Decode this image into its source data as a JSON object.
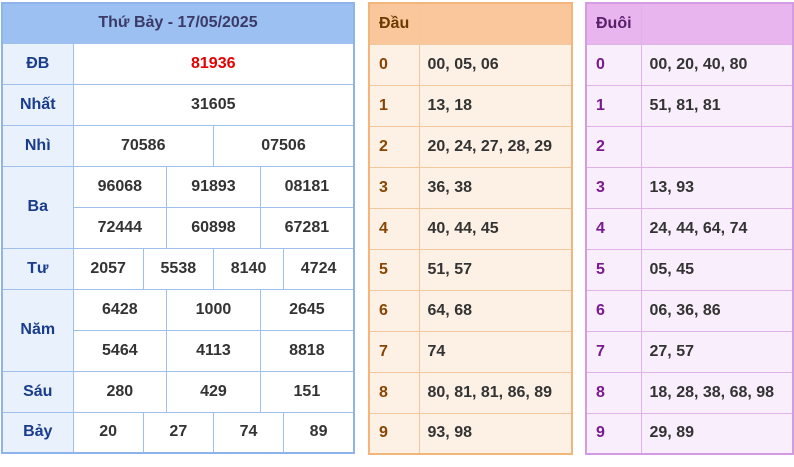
{
  "results": {
    "title": "Thứ Bảy - 17/05/2025",
    "prizes": {
      "db": {
        "label": "ĐB",
        "values": [
          "81936"
        ]
      },
      "nhat": {
        "label": "Nhất",
        "values": [
          "31605"
        ]
      },
      "nhi": {
        "label": "Nhì",
        "values": [
          "70586",
          "07506"
        ]
      },
      "ba": {
        "label": "Ba",
        "values": [
          "96068",
          "91893",
          "08181",
          "72444",
          "60898",
          "67281"
        ]
      },
      "tu": {
        "label": "Tư",
        "values": [
          "2057",
          "5538",
          "8140",
          "4724"
        ]
      },
      "nam": {
        "label": "Năm",
        "values": [
          "6428",
          "1000",
          "2645",
          "5464",
          "4113",
          "8818"
        ]
      },
      "sau": {
        "label": "Sáu",
        "values": [
          "280",
          "429",
          "151"
        ]
      },
      "bay": {
        "label": "Bảy",
        "values": [
          "20",
          "27",
          "74",
          "89"
        ]
      }
    }
  },
  "dau": {
    "header": "Đầu",
    "rows": [
      {
        "digit": "0",
        "values": "00, 05, 06"
      },
      {
        "digit": "1",
        "values": "13, 18"
      },
      {
        "digit": "2",
        "values": "20, 24, 27, 28, 29"
      },
      {
        "digit": "3",
        "values": "36, 38"
      },
      {
        "digit": "4",
        "values": "40, 44, 45"
      },
      {
        "digit": "5",
        "values": "51, 57"
      },
      {
        "digit": "6",
        "values": "64, 68"
      },
      {
        "digit": "7",
        "values": "74"
      },
      {
        "digit": "8",
        "values": "80, 81, 81, 86, 89"
      },
      {
        "digit": "9",
        "values": "93, 98"
      }
    ]
  },
  "duoi": {
    "header": "Đuôi",
    "rows": [
      {
        "digit": "0",
        "values": "00, 20, 40, 80"
      },
      {
        "digit": "1",
        "values": "51, 81, 81"
      },
      {
        "digit": "2",
        "values": ""
      },
      {
        "digit": "3",
        "values": "13, 93"
      },
      {
        "digit": "4",
        "values": "24, 44, 64, 74"
      },
      {
        "digit": "5",
        "values": "05, 45"
      },
      {
        "digit": "6",
        "values": "06, 36, 86"
      },
      {
        "digit": "7",
        "values": "27, 57"
      },
      {
        "digit": "8",
        "values": "18, 28, 38, 68, 98"
      },
      {
        "digit": "9",
        "values": "29, 89"
      }
    ]
  },
  "colors": {
    "results_header": "#9dc0f3",
    "special_prize": "#e60000",
    "dau_header": "#f9c79b",
    "duoi_header": "#e8b5ef"
  }
}
